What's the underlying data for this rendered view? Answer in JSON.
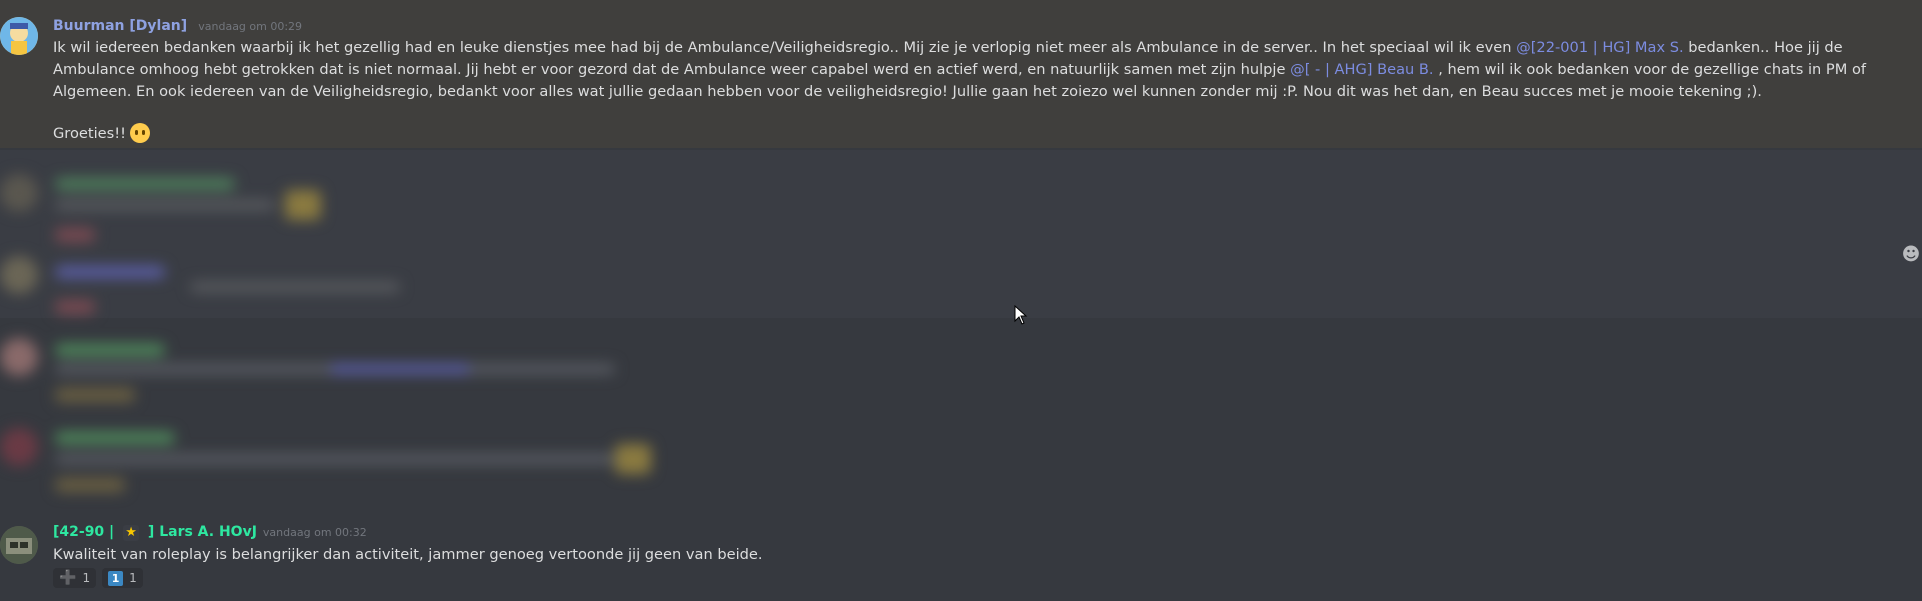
{
  "message1": {
    "username": "Buurman [Dylan]",
    "timestamp": "vandaag om 00:29",
    "text_a": "Ik wil iedereen bedanken waarbij ik het gezellig had en leuke dienstjes mee had bij de Ambulance/Veiligheidsregio.. Mij zie je verlopig niet meer als Ambulance in de server.. In het speciaal wil ik even ",
    "mention_a": "@[22-001 | HG] Max S.",
    "text_b": " bedanken.. Hoe jij de Ambulance omhoog hebt getrokken dat is niet normaal. Jij hebt er voor gezord dat de Ambulance weer capabel werd en actief werd, en natuurlijk samen met zijn hulpje ",
    "mention_b": "@[ - | AHG] Beau B.",
    "text_c": " , hem wil ik ook bedanken voor de gezellige chats in PM of Algemeen. En ook iedereen van de Veiligheidsregio, bedankt voor alles wat jullie gedaan hebben voor de veiligheidsregio! Jullie gaan het zoiezo wel kunnen zonder mij :P. Nou dit was het dan, en Beau succes met je mooie tekening ;).",
    "greeting": "Groeties!!",
    "greeting_emoji": "zipper-mouth-face-icon"
  },
  "message2": {
    "username_prefix": "[42-90 |",
    "username_badge": "★",
    "username_suffix": "] Lars A. HOvJ",
    "timestamp": "vandaag om 00:32",
    "text": "Kwaliteit van roleplay is belangrijker dan activiteit, jammer genoeg vertoonde jij geen van beide.",
    "reactions": [
      {
        "icon": "plus-icon",
        "glyph": "➕",
        "count": "1"
      },
      {
        "icon": "keycap-one-icon",
        "glyph": "1",
        "count": "1"
      }
    ]
  },
  "side_icon": "add-reaction-icon",
  "colors": {
    "background": "#36393f",
    "highlight": "#403f3d",
    "username1": "#8ea1e1",
    "username2": "#2ee8a1",
    "mention": "#7c8ce0"
  }
}
